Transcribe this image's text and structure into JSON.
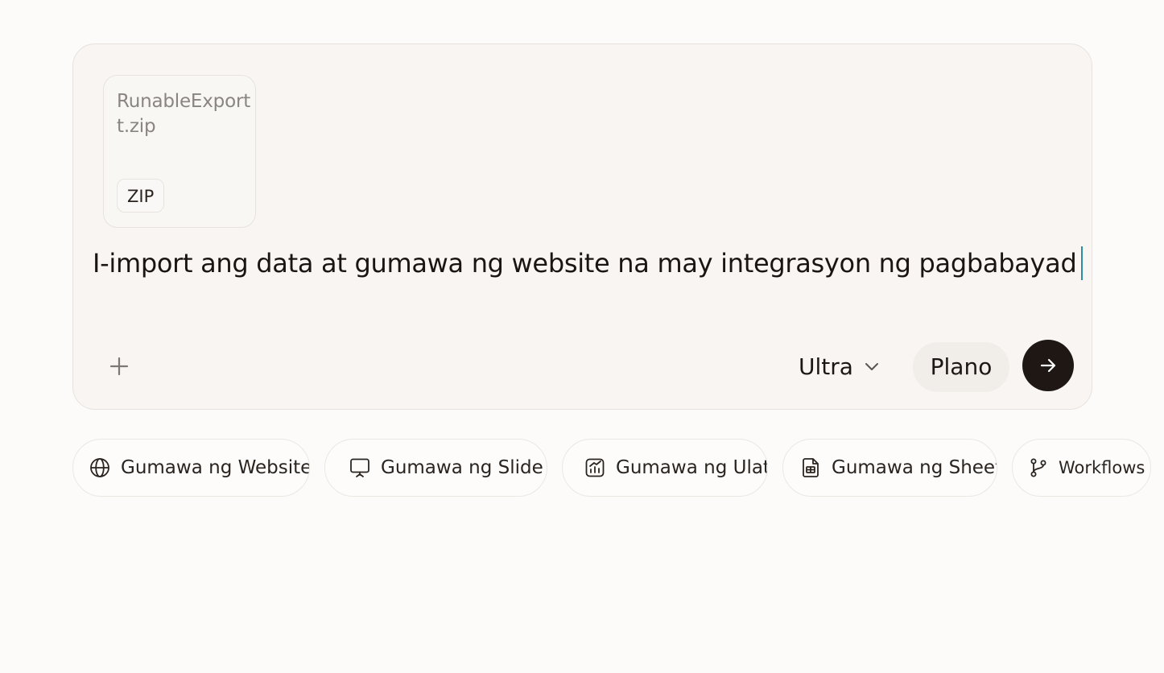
{
  "composer": {
    "attachment": {
      "file_name": "RunableExportt.zip",
      "file_type": "ZIP"
    },
    "prompt_text": "I-import ang data at gumawa ng website na may integrasyon ng pagbabayad",
    "add_icon": "plus-icon",
    "model_label": "Ultra",
    "model_icon": "chevron-down-icon",
    "plan_label": "Plano",
    "send_icon": "arrow-right-icon",
    "accent_color": "#1e1713",
    "caret_color": "#2a8fa5"
  },
  "suggestions": [
    {
      "label": "Gumawa ng Website",
      "icon": "globe-icon"
    },
    {
      "label": "Gumawa ng Slide",
      "icon": "presentation-icon"
    },
    {
      "label": "Gumawa ng Ulat",
      "icon": "chart-report-icon"
    },
    {
      "label": "Gumawa ng Sheet",
      "icon": "spreadsheet-file-icon"
    },
    {
      "label": "Workflows",
      "icon": "git-branch-icon"
    }
  ]
}
